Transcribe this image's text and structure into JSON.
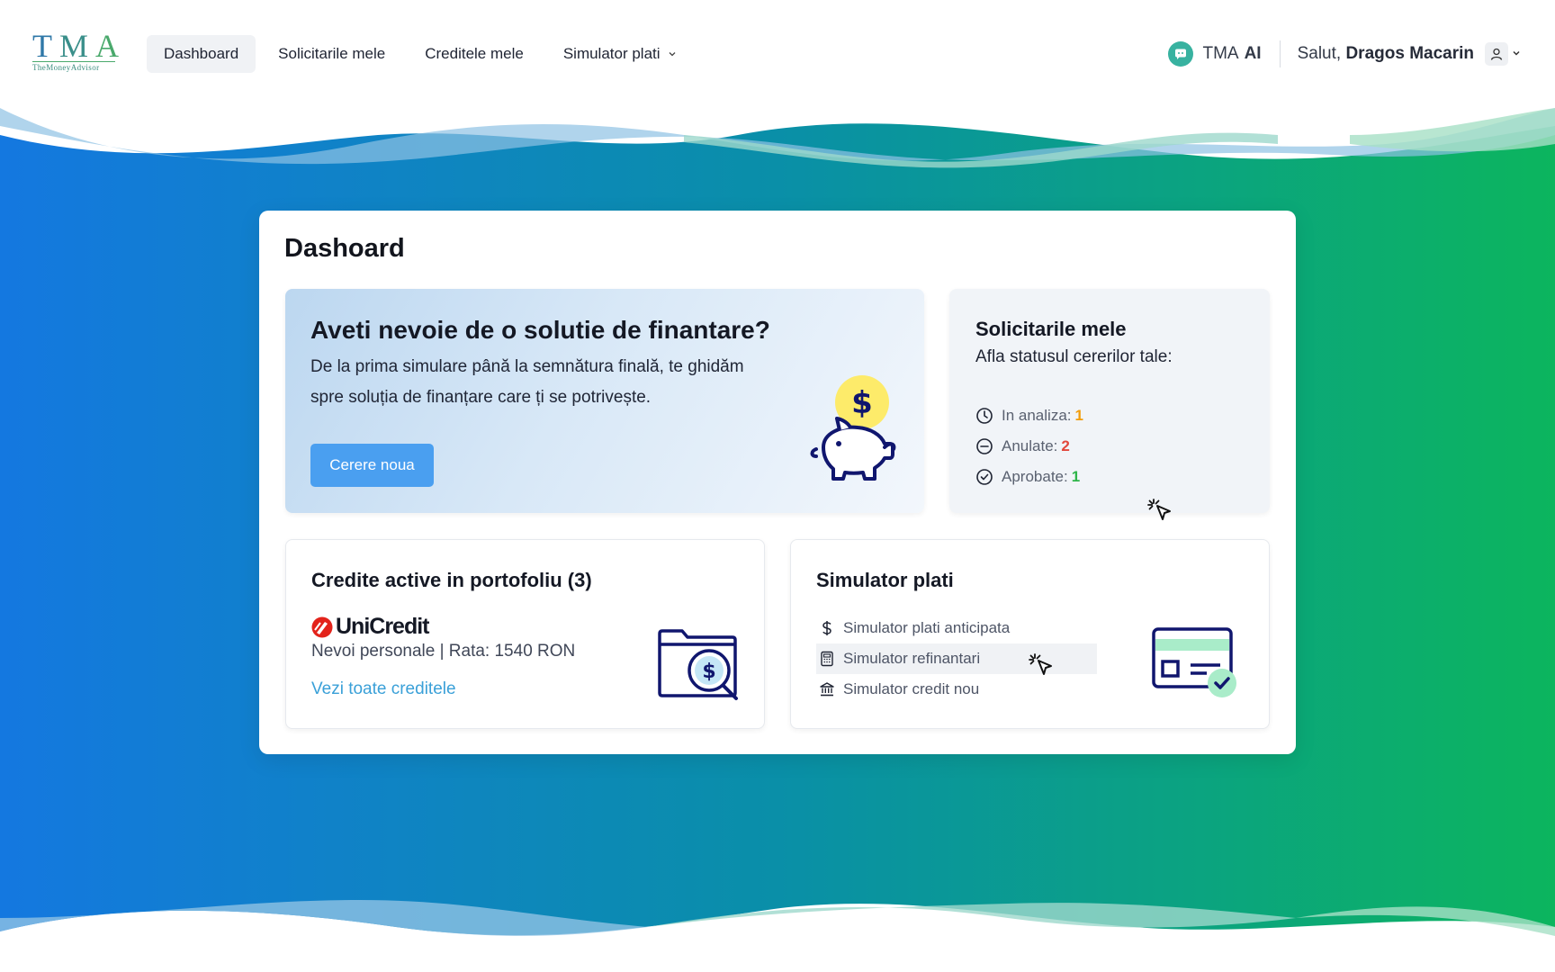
{
  "colors": {
    "gradient_left": "#1478e0",
    "gradient_right": "#0cb55e",
    "primary_button": "#4a9ff0",
    "link": "#3aa0d8",
    "status_analysis": "#f29d0c",
    "status_cancelled": "#e2473b",
    "status_approved": "#2fb54a"
  },
  "logo": {
    "t": "T",
    "m": "M",
    "a": "A",
    "tagline": "TheMoneyAdvisor"
  },
  "nav": {
    "items": [
      {
        "label": "Dashboard",
        "active": true
      },
      {
        "label": "Solicitarile mele"
      },
      {
        "label": "Creditele mele"
      },
      {
        "label": "Simulator plati",
        "icon": "chevron-down-icon"
      }
    ]
  },
  "header": {
    "ai_prefix": "TMA",
    "ai_suffix": "AI",
    "ai_icon": "chat-bubble-icon",
    "greeting": "Salut,",
    "user_name": "Dragos Macarin",
    "user_icon": "user-icon"
  },
  "page": {
    "title": "Dashoard"
  },
  "hero": {
    "title": "Aveti nevoie de o solutie de finantare?",
    "text": "De la prima simulare până la semnătura finală, te ghidăm spre soluția de finanțare care ți se potrivește.",
    "button": "Cerere noua",
    "illustration": "piggy-bank-icon",
    "coin_symbol": "$"
  },
  "requests": {
    "title": "Solicitarile mele",
    "lead": "Afla statusul cererilor tale:",
    "items": [
      {
        "label": "In analiza:",
        "value": "1",
        "icon": "clock-icon"
      },
      {
        "label": "Anulate:",
        "value": "2",
        "icon": "minus-circle-icon"
      },
      {
        "label": "Aprobate:",
        "value": "1",
        "icon": "check-circle-icon"
      }
    ]
  },
  "credits": {
    "title": "Credite active in portofoliu (3)",
    "bank": "UniCredit",
    "line": "Nevoi personale | Rata: 1540 RON",
    "link": "Vezi toate creditele",
    "illustration": "folder-search-icon",
    "coin_symbol": "$"
  },
  "simulator": {
    "title": "Simulator plati",
    "items": [
      {
        "label": "Simulator plati anticipata",
        "icon": "dollar-icon"
      },
      {
        "label": "Simulator refinantari",
        "icon": "calculator-icon",
        "hovered": true
      },
      {
        "label": "Simulator credit nou",
        "icon": "bank-icon"
      }
    ],
    "illustration": "credit-card-check-icon"
  }
}
